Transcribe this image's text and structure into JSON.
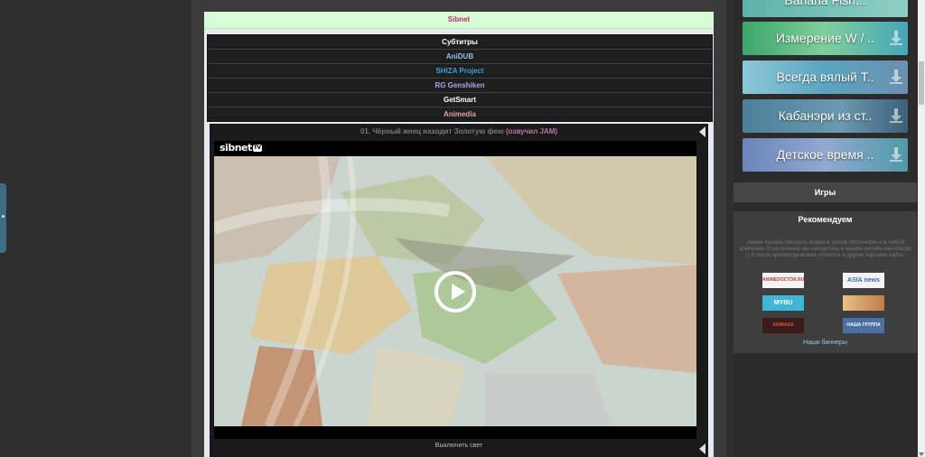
{
  "player": {
    "source_label": "Sibnet",
    "dubs": [
      {
        "label": "Субтитры",
        "color": "#ffffff"
      },
      {
        "label": "AniDUB",
        "color": "#8fc3e6"
      },
      {
        "label": "SHIZA Project",
        "color": "#3e9fe0"
      },
      {
        "label": "RG Genshiken",
        "color": "#b8a0e6"
      },
      {
        "label": "GetSmart",
        "color": "#ffffff"
      },
      {
        "label": "Animedia",
        "color": "#e0a0b0"
      }
    ],
    "episode_title": "01. Чёрный жнец находит Золотую фею",
    "episode_voice": "(озвучил JAM)",
    "sibnet_logo": "sibnet",
    "sibnet_logo_tv": "TV",
    "lights_off": "Выключить свет"
  },
  "sidebar": {
    "thumbs": [
      {
        "label": "Banana Fish...",
        "bg": "#5db2a8"
      },
      {
        "label": "Измерение W / ..",
        "bg": "#3ca66a"
      },
      {
        "label": "Всегда вялый Т..",
        "bg": "#6fb6c8"
      },
      {
        "label": "Кабанэри из ст..",
        "bg": "#4d7f9a"
      },
      {
        "label": "Детское время ..",
        "bg": "#6a85b8"
      }
    ],
    "games_label": "Игры",
    "recommend_label": "Рекомендуем",
    "recommend_text": "Аниме онлайн смотреть можно в любой обстановке и в любой компании. Если конечно вы находитесь в нашем онлайн кинотеатре :) А после просмотра можно посетить и другие хорошие сайты:",
    "banners": [
      {
        "label": "ANIMEDOCTOR.RU"
      },
      {
        "label": "ASIA news"
      },
      {
        "label": "MYBU"
      },
      {
        "label": ""
      },
      {
        "label": "ANIMAKE"
      },
      {
        "label": "НАША ГРУППА"
      }
    ],
    "our_banners": "Наши баннеры"
  }
}
